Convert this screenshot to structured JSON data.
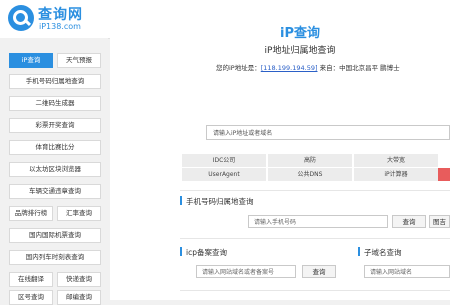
{
  "header": {
    "site_name": "查询网",
    "site_url": "iP138.com"
  },
  "sidebar": {
    "items": [
      {
        "label": "iP查询"
      },
      {
        "label": "天气预报"
      },
      {
        "label": "手机号码归属地查询"
      },
      {
        "label": "二维码生成器"
      },
      {
        "label": "彩票开奖查询"
      },
      {
        "label": "体育比赛比分"
      },
      {
        "label": "以太坊区块浏览器"
      },
      {
        "label": "车辆交通违章查询"
      },
      {
        "label": "品牌排行榜"
      },
      {
        "label": "汇率查询"
      },
      {
        "label": "国内国际机票查询"
      },
      {
        "label": "国内列车时刻表查询"
      },
      {
        "label": "在线翻译"
      },
      {
        "label": "快递查询"
      },
      {
        "label": "区号查询"
      },
      {
        "label": "邮编查询"
      }
    ]
  },
  "ip_section": {
    "title": "iP查询",
    "subtitle": "iP地址归属地查询",
    "ip_prefix": "您的iP地址是：",
    "ip_value": "[118.199.194.59]",
    "ip_location": " 来自：中国北京昌平 鹏博士",
    "input_placeholder": "请输入iP地址或者域名"
  },
  "tools": [
    {
      "label": "IDC公司"
    },
    {
      "label": "高防"
    },
    {
      "label": "大带宽"
    },
    {
      "label": "UserAgent"
    },
    {
      "label": "公共DNS"
    },
    {
      "label": "iP计算器"
    }
  ],
  "phone_panel": {
    "title": "手机号码归属地查询",
    "placeholder": "请输入手机号码",
    "button": "查询",
    "button2": "图吉"
  },
  "icp_panel": {
    "title": "icp备案查询",
    "placeholder": "请输入网站域名或者备案号",
    "button": "查询"
  },
  "subdomain_panel": {
    "title": "子域名查询",
    "placeholder": "请输入网站域名"
  },
  "colors": {
    "accent": "#2b8fe0",
    "red": "#e85c5c"
  }
}
